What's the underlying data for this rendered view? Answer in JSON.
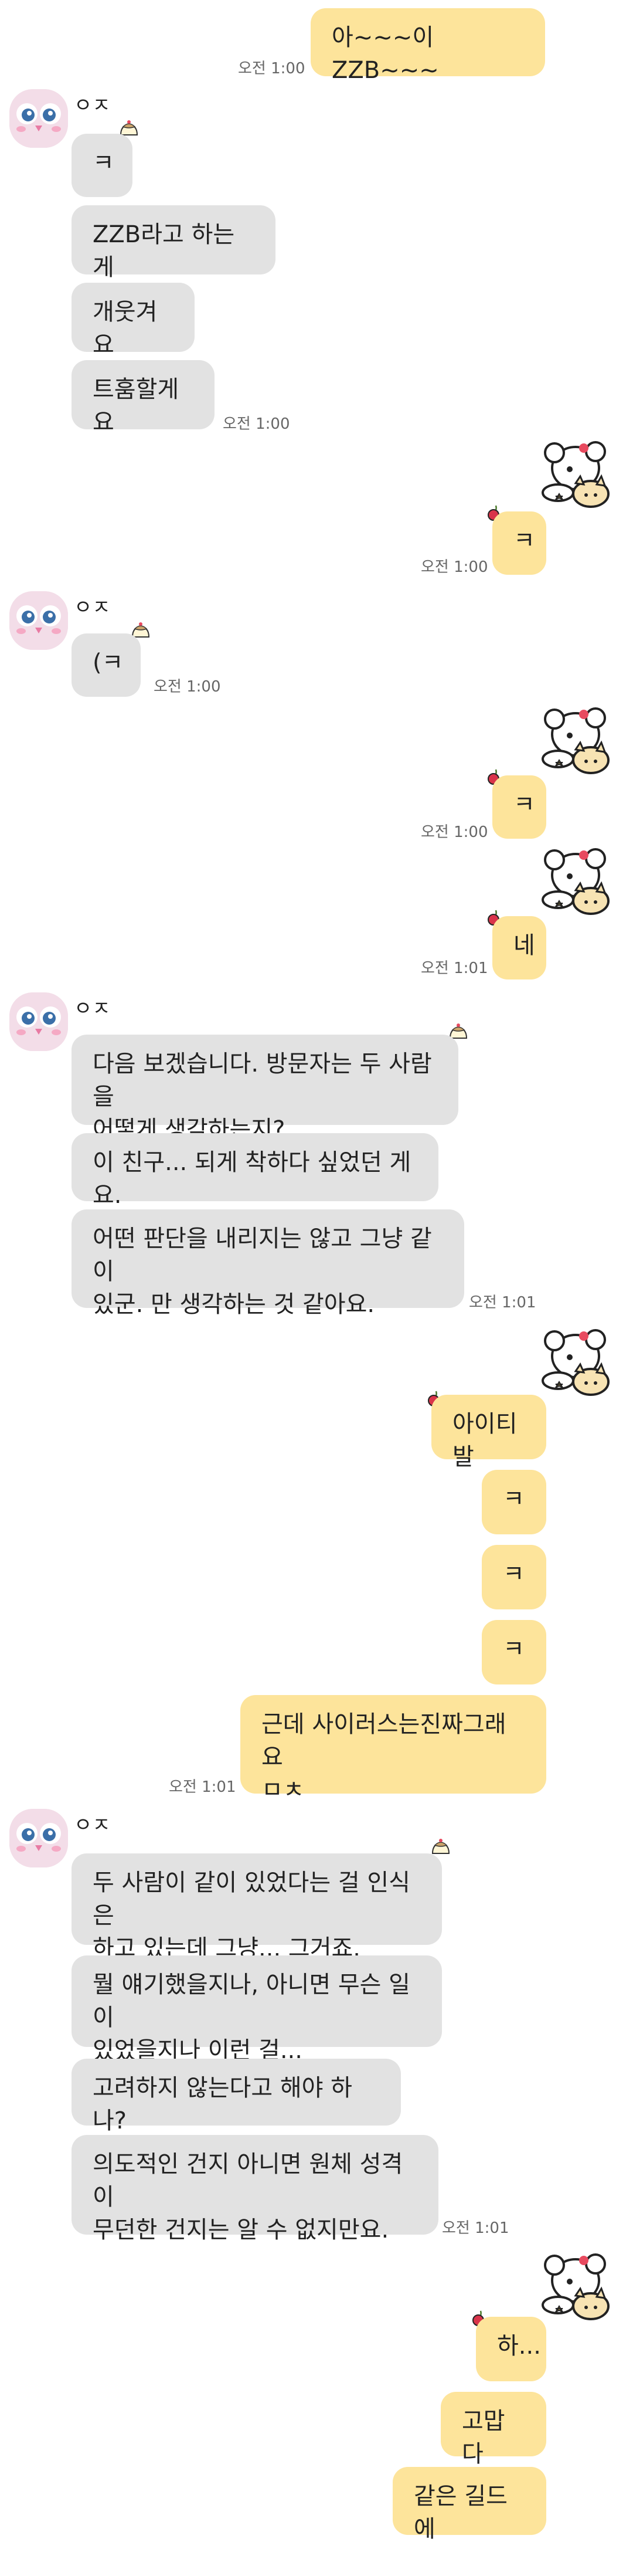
{
  "chat": {
    "sender_name": "ㅇㅈ",
    "messages": {
      "m1": "아~~~이 ZZB~~~",
      "o1": "ㅋ",
      "o2": "ZZB라고 하는 게",
      "o3": "개웃겨요",
      "o4": "트훔할게요",
      "m2": "ㅋ",
      "o5": "(ㅋ",
      "m3": "ㅋ",
      "m4": "네",
      "o6": "다음 보겠습니다. 방문자는 두 사람을\n어떻게 생각하는지?",
      "o7": "이 친구... 되게 착하다 싶었던 게요.",
      "o8": "어떤 판단을 내리지는 않고 그냥 같이\n있군. 만 생각하는 것 같아요.",
      "m5": "아이티발",
      "m6": "ㅋ",
      "m7": "ㅋ",
      "m8": "ㅋ",
      "m9": "근데 사이러스는진짜그래요\nㅁㅊ",
      "o9": "두 사람이 같이 있었다는 걸 인식은\n하고 있는데 그냥... 그거죠.",
      "o10": "뭘 얘기했을지나, 아니면 무슨 일이\n있었을지나 이런 걸...",
      "o11": "고려하지 않는다고 해야 하나?",
      "o12": "의도적인 건지 아니면 원체 성격이\n무던한 건지는 알 수 없지만요.",
      "m10": "하...",
      "m11": "고맙다",
      "m12": "같은 길드에"
    },
    "times": {
      "t1": "오전 1:00",
      "t2": "오전 1:00",
      "t3": "오전 1:00",
      "t4": "오전 1:00",
      "t5": "오전 1:00",
      "t6": "오전 1:01",
      "t7": "오전 1:01",
      "t8": "오전 1:01",
      "t9": "오전 1:01"
    }
  },
  "colors": {
    "my_bubble": "#fde49b",
    "other_bubble": "#e2e2e2",
    "background": "#ffffff"
  },
  "icons": {
    "avatar": "pink-owl-avatar",
    "badge": "cream-pudding-icon",
    "sticker": "white-bear-and-cat-sticker",
    "cherry": "cherry-icon"
  }
}
